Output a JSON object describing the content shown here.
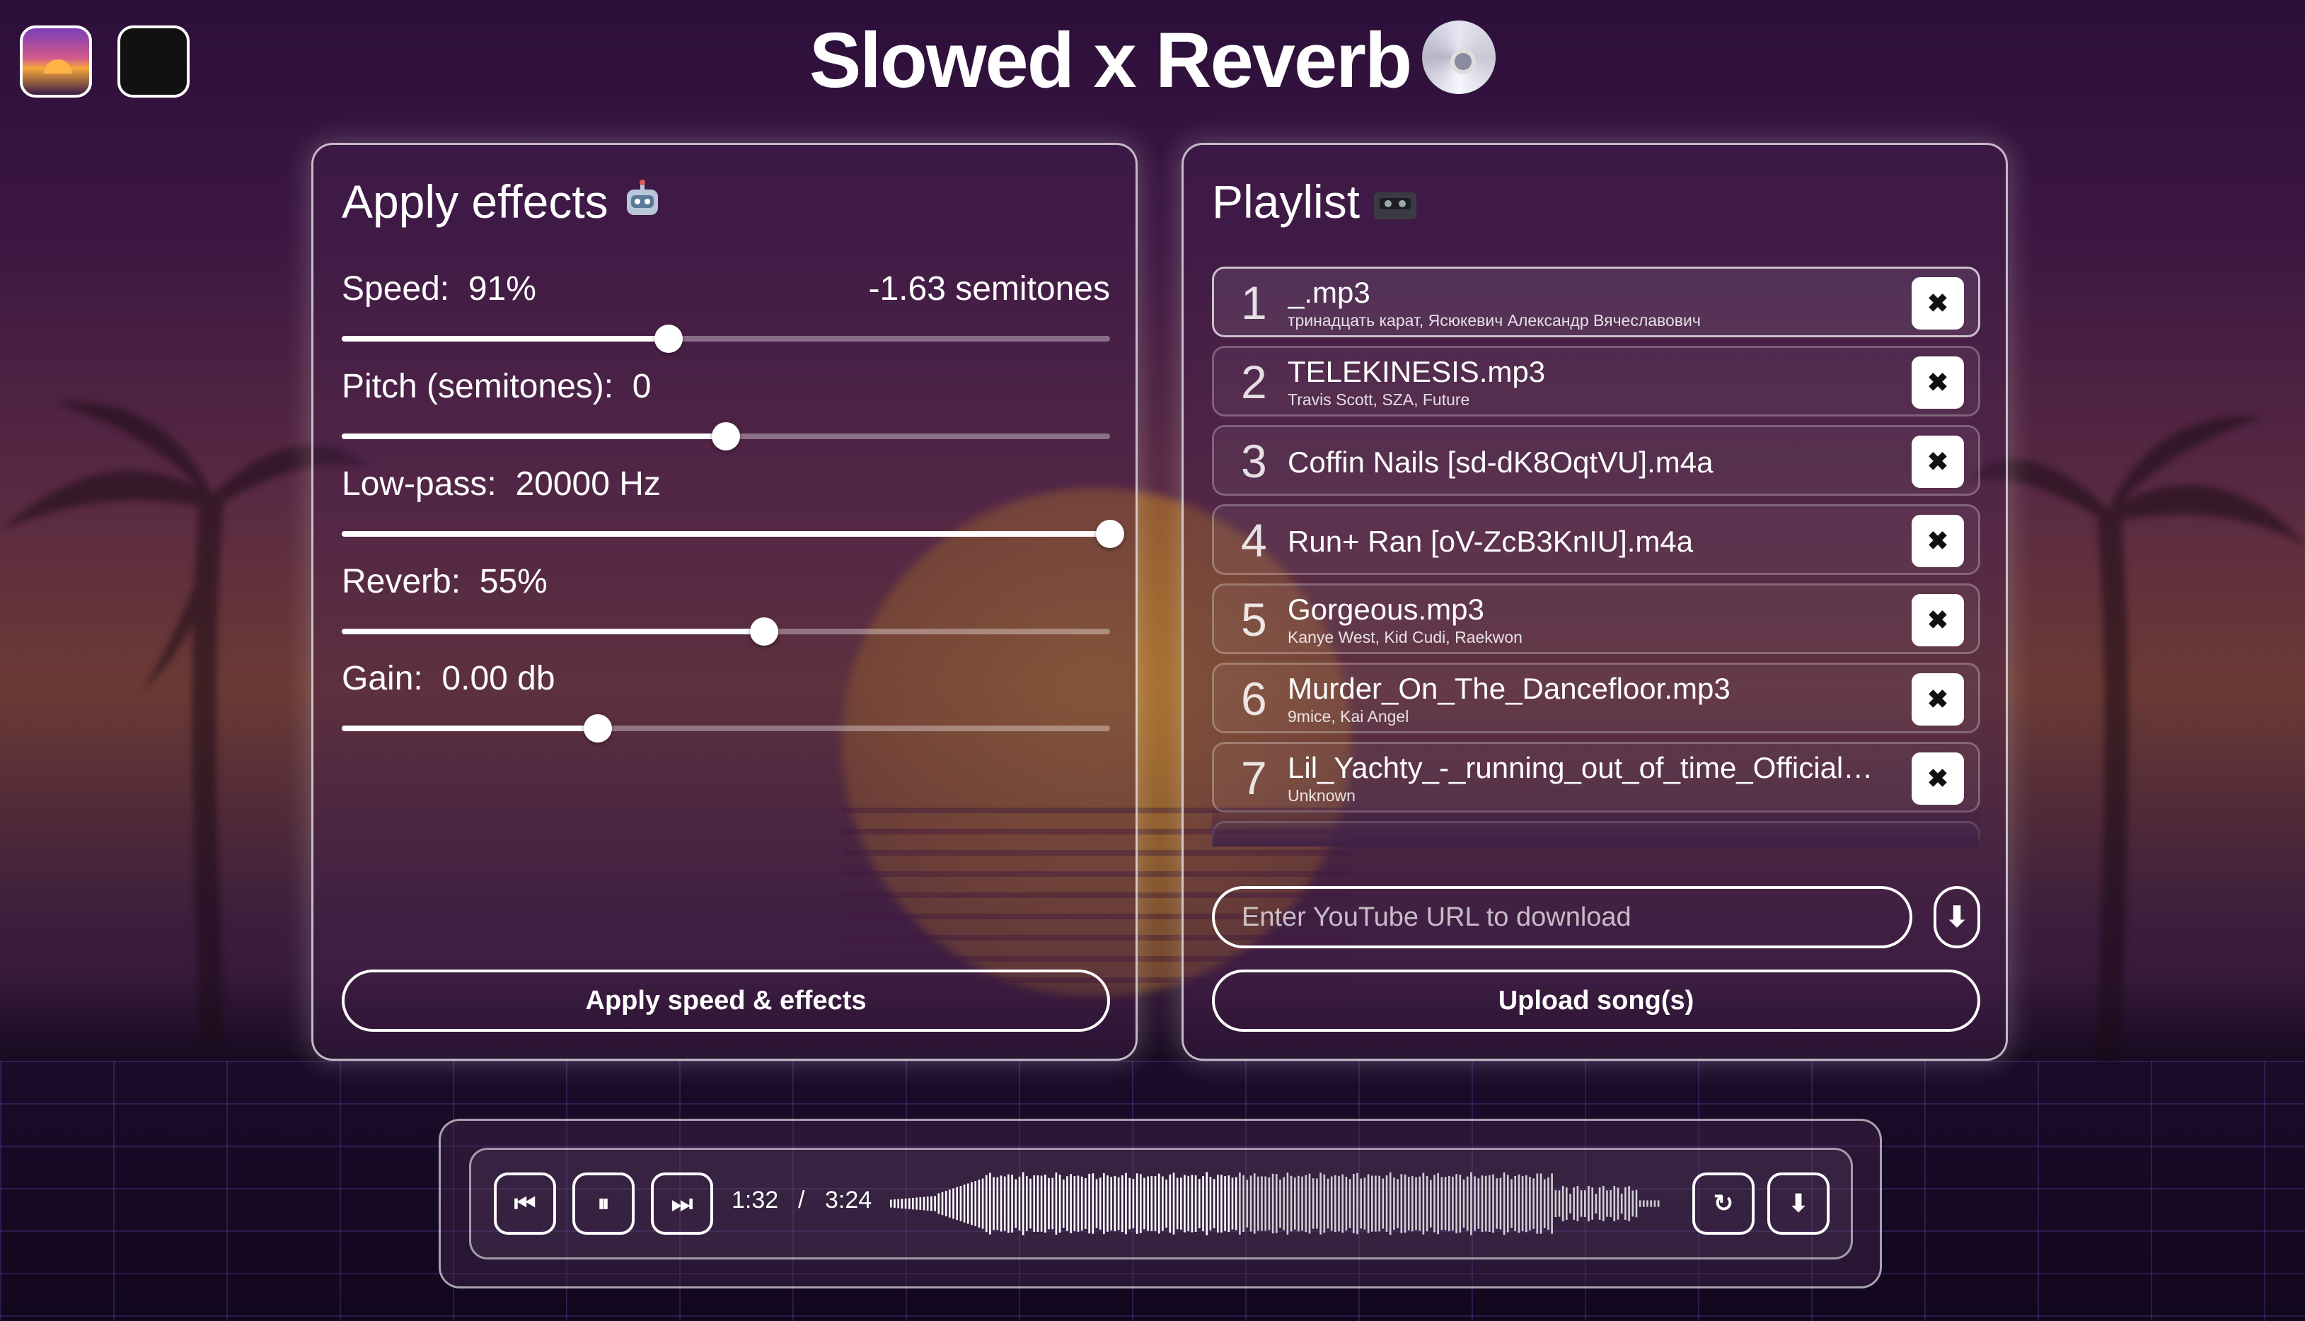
{
  "app": {
    "title": "Slowed x Reverb",
    "theme_buttons": [
      {
        "name": "sunset-theme",
        "color": "#d35a8c"
      },
      {
        "name": "dark-theme",
        "color": "#111111"
      }
    ]
  },
  "effects": {
    "title": "Apply effects",
    "title_emoji": "🤖",
    "sliders": [
      {
        "key": "speed",
        "label": "Speed:",
        "value_text": "91%",
        "extra": "-1.63 semitones",
        "level": 0.425
      },
      {
        "key": "pitch",
        "label": "Pitch (semitones):",
        "value_text": "0",
        "extra": "",
        "level": 0.5
      },
      {
        "key": "lowpass",
        "label": "Low-pass:",
        "value_text": "20000 Hz",
        "extra": "",
        "level": 1.0
      },
      {
        "key": "reverb",
        "label": "Reverb:",
        "value_text": "55%",
        "extra": "",
        "level": 0.55
      },
      {
        "key": "gain",
        "label": "Gain:",
        "value_text": "0.00 db",
        "extra": "",
        "level": 0.333
      }
    ],
    "apply_label": "Apply speed & effects"
  },
  "playlist": {
    "title": "Playlist",
    "title_emoji": "📼",
    "items": [
      {
        "num": "1",
        "title": "_.mp3",
        "subtitle": "тринадцать карат, Ясюкевич Александр Вячеславович",
        "active": true
      },
      {
        "num": "2",
        "title": "TELEKINESIS.mp3",
        "subtitle": "Travis Scott, SZA, Future",
        "active": false
      },
      {
        "num": "3",
        "title": "Coffin Nails [sd-dK8OqtVU].m4a",
        "subtitle": "",
        "active": false
      },
      {
        "num": "4",
        "title": "Run+ Ran [oV-ZcB3KnIU].m4a",
        "subtitle": "",
        "active": false
      },
      {
        "num": "5",
        "title": "Gorgeous.mp3",
        "subtitle": "Kanye West, Kid Cudi, Raekwon",
        "active": false
      },
      {
        "num": "6",
        "title": "Murder_On_The_Dancefloor.mp3",
        "subtitle": "9mice, Kai Angel",
        "active": false
      },
      {
        "num": "7",
        "title": "Lil_Yachty_-_running_out_of_time_Official_Audi...",
        "subtitle": "Unknown",
        "active": false
      }
    ],
    "remove_icon": "✖",
    "url_placeholder": "Enter YouTube URL to download",
    "download_icon": "⬇",
    "upload_label": "Upload song(s)"
  },
  "player": {
    "prev_icon": "⏮",
    "pause_icon": "⏸",
    "next_icon": "⏭",
    "current_time": "1:32",
    "separator": "/",
    "total_time": "3:24",
    "loop_icon": "↻",
    "download_icon": "⬇",
    "progress": 0.45
  }
}
